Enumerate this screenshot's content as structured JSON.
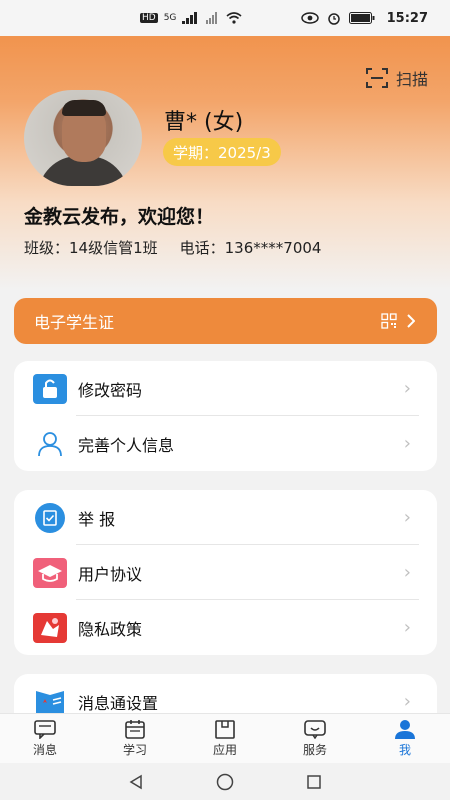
{
  "status_bar": {
    "network": "HD",
    "signal": "5G",
    "time": "15:27"
  },
  "header": {
    "scan_label": "扫描"
  },
  "profile": {
    "name": "曹* (女)",
    "term": "学期：2025/3",
    "welcome": "金教云发布，欢迎您！",
    "class_info": "班级：14级信管1班",
    "phone_info": "电话：136****7004"
  },
  "student_card": {
    "label": "电子学生证"
  },
  "menu_group_1": [
    {
      "label": "修改密码",
      "icon": "lock-icon",
      "color": "#2b8fe0"
    },
    {
      "label": "完善个人信息",
      "icon": "user-outline-icon",
      "color": "#2b8fe0"
    }
  ],
  "menu_group_2": [
    {
      "label": "举 报",
      "icon": "report-icon",
      "color": "#2b8fe0"
    },
    {
      "label": "用户协议",
      "icon": "mortarboard-icon",
      "color": "#f0607a"
    },
    {
      "label": "隐私政策",
      "icon": "privacy-icon",
      "color": "#e53935"
    }
  ],
  "menu_group_3": [
    {
      "label": "消息通设置",
      "icon": "message-settings-icon",
      "color": "#2b8fe0"
    }
  ],
  "tabs": [
    {
      "label": "消息",
      "icon": "message-icon"
    },
    {
      "label": "学习",
      "icon": "calendar-icon"
    },
    {
      "label": "应用",
      "icon": "app-box-icon"
    },
    {
      "label": "服务",
      "icon": "service-chat-icon"
    },
    {
      "label": "我",
      "icon": "person-icon",
      "active": true
    }
  ],
  "colors": {
    "accent": "#ee8a3c",
    "active_tab": "#1a75d8",
    "badge": "#f7c948"
  }
}
